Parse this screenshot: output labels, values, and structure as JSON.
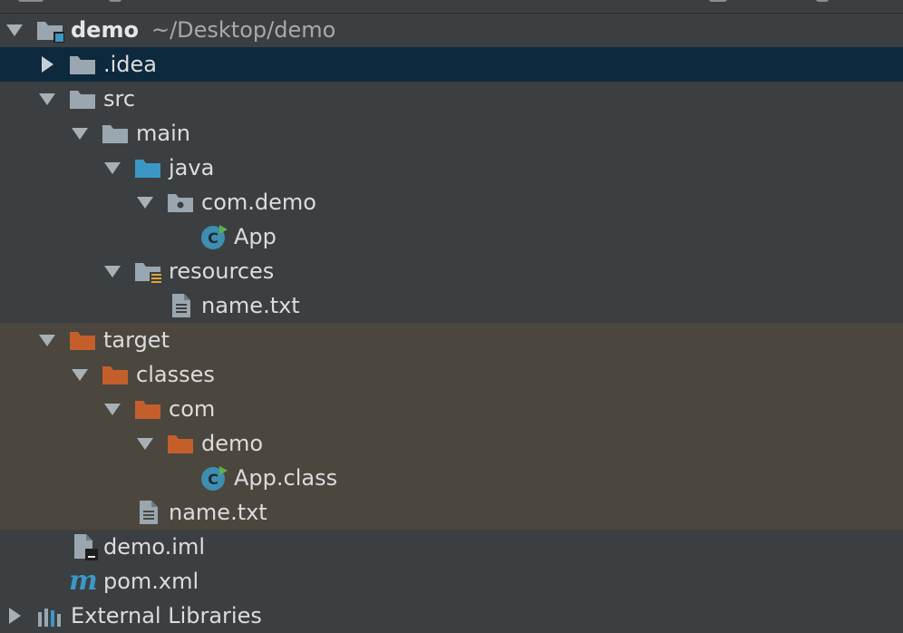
{
  "colors": {
    "background": "#3c3f41",
    "selected_row": "#0d293e",
    "excluded_row": "#4b463e",
    "folder_gray": "#9aa7b0",
    "folder_source": "#3d97c6",
    "folder_excluded": "#c45f2c",
    "text": "#dcdcdc"
  },
  "tree": {
    "root": {
      "label": "demo",
      "path": "~/Desktop/demo"
    },
    "nodes": [
      {
        "label": ".idea"
      },
      {
        "label": "src"
      },
      {
        "label": "main"
      },
      {
        "label": "java"
      },
      {
        "label": "com.demo"
      },
      {
        "label": "App"
      },
      {
        "label": "resources"
      },
      {
        "label": "name.txt"
      },
      {
        "label": "target"
      },
      {
        "label": "classes"
      },
      {
        "label": "com"
      },
      {
        "label": "demo"
      },
      {
        "label": "App.class"
      },
      {
        "label": "name.txt"
      },
      {
        "label": "demo.iml"
      },
      {
        "label": "pom.xml"
      },
      {
        "label": "External Libraries"
      }
    ]
  }
}
